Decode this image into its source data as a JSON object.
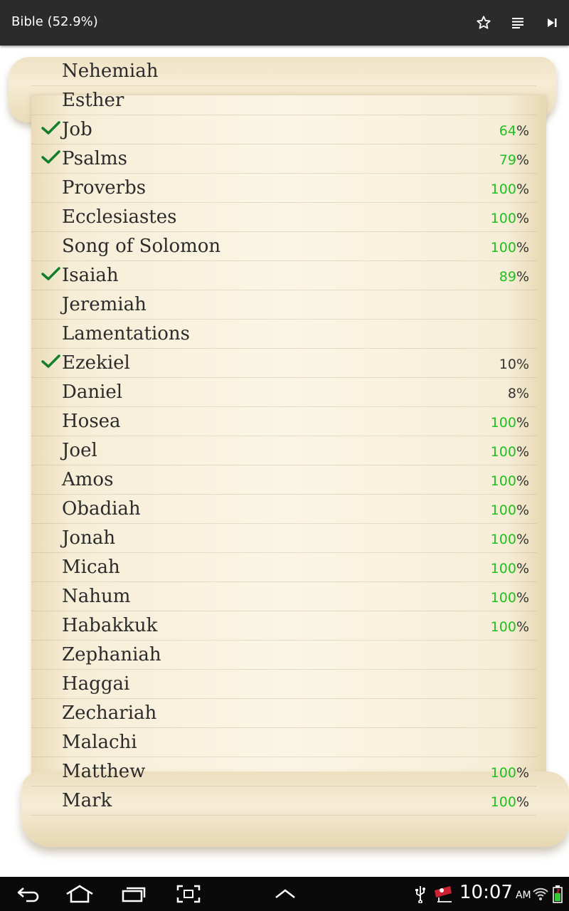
{
  "app": {
    "title": "Bible (52.9%)"
  },
  "toolbar": {
    "actions": [
      {
        "icon": "star-outline-icon",
        "label": "Favorite"
      },
      {
        "icon": "list-icon",
        "label": "Chapters"
      },
      {
        "icon": "skip-next-icon",
        "label": "Next"
      }
    ]
  },
  "books": [
    {
      "name": "Nehemiah",
      "checked": false,
      "percent": "",
      "percent_color": ""
    },
    {
      "name": "Esther",
      "checked": false,
      "percent": "",
      "percent_color": ""
    },
    {
      "name": "Job",
      "checked": true,
      "percent": "64",
      "percent_color": "green"
    },
    {
      "name": "Psalms",
      "checked": true,
      "percent": "79",
      "percent_color": "green"
    },
    {
      "name": "Proverbs",
      "checked": false,
      "percent": "100",
      "percent_color": "green"
    },
    {
      "name": "Ecclesiastes",
      "checked": false,
      "percent": "100",
      "percent_color": "green"
    },
    {
      "name": "Song of Solomon",
      "checked": false,
      "percent": "100",
      "percent_color": "green"
    },
    {
      "name": "Isaiah",
      "checked": true,
      "percent": "89",
      "percent_color": "green"
    },
    {
      "name": "Jeremiah",
      "checked": false,
      "percent": "",
      "percent_color": ""
    },
    {
      "name": "Lamentations",
      "checked": false,
      "percent": "",
      "percent_color": ""
    },
    {
      "name": "Ezekiel",
      "checked": true,
      "percent": "10",
      "percent_color": "dark"
    },
    {
      "name": "Daniel",
      "checked": false,
      "percent": "8",
      "percent_color": "dark"
    },
    {
      "name": "Hosea",
      "checked": false,
      "percent": "100",
      "percent_color": "green"
    },
    {
      "name": "Joel",
      "checked": false,
      "percent": "100",
      "percent_color": "green"
    },
    {
      "name": "Amos",
      "checked": false,
      "percent": "100",
      "percent_color": "green"
    },
    {
      "name": "Obadiah",
      "checked": false,
      "percent": "100",
      "percent_color": "green"
    },
    {
      "name": "Jonah",
      "checked": false,
      "percent": "100",
      "percent_color": "green"
    },
    {
      "name": "Micah",
      "checked": false,
      "percent": "100",
      "percent_color": "green"
    },
    {
      "name": "Nahum",
      "checked": false,
      "percent": "100",
      "percent_color": "green"
    },
    {
      "name": "Habakkuk",
      "checked": false,
      "percent": "100",
      "percent_color": "green"
    },
    {
      "name": "Zephaniah",
      "checked": false,
      "percent": "",
      "percent_color": ""
    },
    {
      "name": "Haggai",
      "checked": false,
      "percent": "",
      "percent_color": ""
    },
    {
      "name": "Zechariah",
      "checked": false,
      "percent": "",
      "percent_color": ""
    },
    {
      "name": "Malachi",
      "checked": false,
      "percent": "",
      "percent_color": ""
    },
    {
      "name": "Matthew",
      "checked": false,
      "percent": "100",
      "percent_color": "green"
    },
    {
      "name": "Mark",
      "checked": false,
      "percent": "100",
      "percent_color": "green"
    }
  ],
  "percent_sign": "%",
  "colors": {
    "progress_green": "#1fc01f",
    "check_green": "#0f7f2a",
    "actionbar_bg": "#2b2b2b",
    "navbar_bg": "#0a0a0a",
    "parchment": "#f7eed8"
  },
  "navbar": {
    "icons": [
      "back-icon",
      "home-icon",
      "recent-apps-icon",
      "screenshot-icon",
      "menu-up-icon"
    ],
    "status_icons": [
      "usb-icon",
      "notification-icon",
      "wifi-icon",
      "battery-icon"
    ],
    "time": "10:07",
    "ampm": "AM"
  }
}
